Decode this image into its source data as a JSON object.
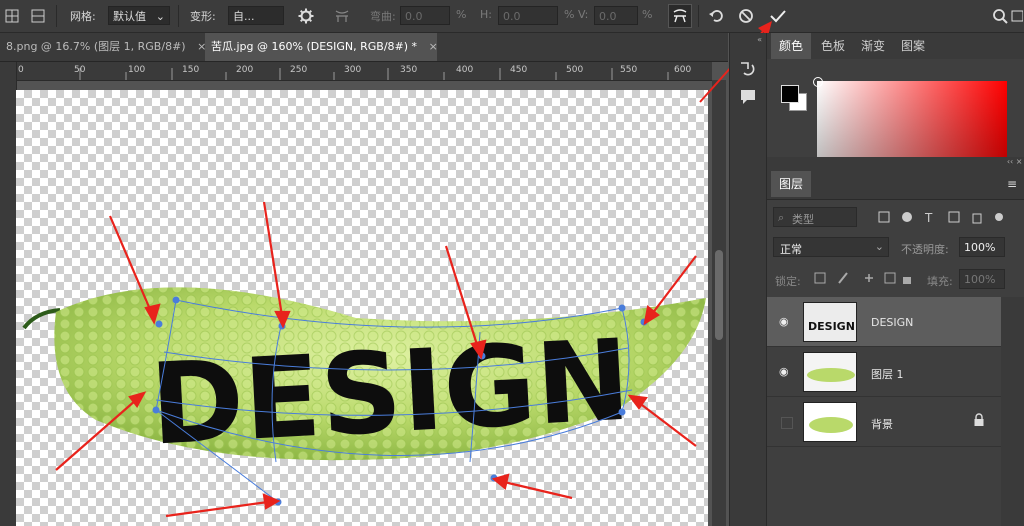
{
  "options_bar": {
    "grid_label": "网格:",
    "grid_value": "默认值",
    "warp_label": "变形:",
    "warp_value": "自...",
    "bend_label": "弯曲:",
    "bend_value": "0.0",
    "h_label": "H:",
    "h_value": "0.0",
    "v_label": "V:",
    "v_value": "0.0",
    "percent": "%"
  },
  "tabs": [
    {
      "label": "8.png @ 16.7% (图层 1, RGB/8#)",
      "close": "×"
    },
    {
      "label": "苦瓜.jpg @ 160% (DESIGN, RGB/8#) *",
      "close": "×"
    }
  ],
  "ruler": {
    "labels": [
      "0",
      "50",
      "100",
      "150",
      "200",
      "250",
      "300",
      "350",
      "400",
      "450",
      "500",
      "550",
      "600"
    ]
  },
  "canvas": {
    "warped_text": "DESIGN"
  },
  "color_panel": {
    "tabs": [
      "颜色",
      "色板",
      "渐变",
      "图案"
    ],
    "foreground": "#000000",
    "background": "#ffffff",
    "hue": "#ff0000"
  },
  "layers_panel": {
    "title": "图层",
    "filter_placeholder": "类型",
    "blend_mode": "正常",
    "opacity_label": "不透明度:",
    "opacity_value": "100%",
    "lock_label": "锁定:",
    "fill_label": "填充:",
    "fill_value": "100%",
    "layers": [
      {
        "name": "DESIGN",
        "visible": true,
        "selected": true
      },
      {
        "name": "图层 1",
        "visible": true,
        "selected": false
      },
      {
        "name": "背景",
        "visible": false,
        "selected": false,
        "locked": true
      }
    ]
  },
  "colors": {
    "accent_red": "#e8231c",
    "handle_blue": "#4a7ddb"
  }
}
